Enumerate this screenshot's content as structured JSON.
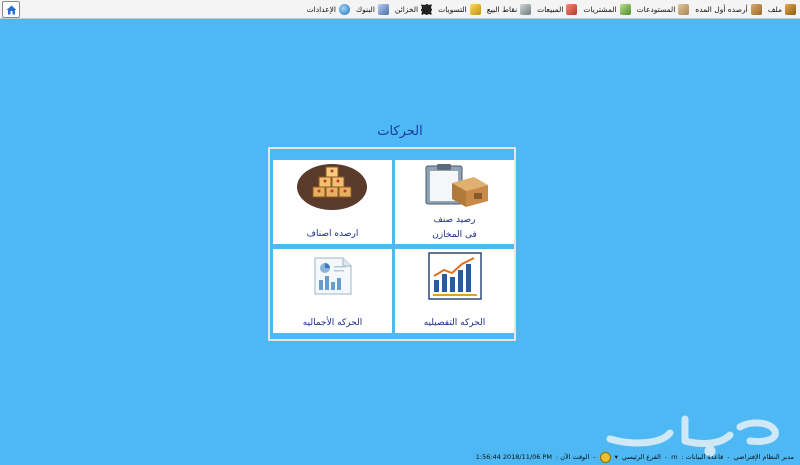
{
  "menubar": {
    "items": [
      {
        "label": "ملف",
        "icon": "file-icon",
        "color": "#c8862a"
      },
      {
        "label": "أرصده أول المده",
        "icon": "boxes-icon",
        "color": "#b98a4a"
      },
      {
        "label": "المستودعات",
        "icon": "warehouse-icon",
        "color": "#a88b5a"
      },
      {
        "label": "المشتريات",
        "icon": "purchases-icon",
        "color": "#6aa84f"
      },
      {
        "label": "المبيعات",
        "icon": "cart-icon",
        "color": "#c0392b"
      },
      {
        "label": "نقاط البيع",
        "icon": "pos-icon",
        "color": "#7f8c8d"
      },
      {
        "label": "التسويات",
        "icon": "settlements-icon",
        "color": "#e6b422"
      },
      {
        "label": "الخزائن",
        "icon": "safe-icon",
        "color": "#333333"
      },
      {
        "label": "البنوك",
        "icon": "bank-icon",
        "color": "#5b7fb5"
      },
      {
        "label": "الإعدادات",
        "icon": "settings-globe-icon",
        "color": "#2e86c1"
      }
    ]
  },
  "main": {
    "title": "الحركات",
    "tiles": [
      {
        "label_line1": "رصيد صنف",
        "label_line2": "فى المخازن",
        "icon": "clipboard-box-icon"
      },
      {
        "label_line1": "ارصده اصناف",
        "label_line2": "",
        "icon": "stacked-boxes-icon"
      },
      {
        "label_line1": "الحركه التفصيليه",
        "label_line2": "",
        "icon": "bar-chart-report-icon"
      },
      {
        "label_line1": "الحركه الأجماليه",
        "label_line2": "",
        "icon": "summary-report-icon"
      }
    ]
  },
  "status": {
    "user": "مدير النظام الإفتراضي",
    "db_label": "قاعدة البيانات :",
    "db_value": "m",
    "branch_label": "الفرع الرئيسي",
    "time_label": "الوقت الآن :",
    "time_value": "1:56:44 2018/11/06 PM"
  },
  "colors": {
    "background": "#4db8f4",
    "tile_text": "#1b2c8c",
    "title_text": "#1a3aa0"
  }
}
